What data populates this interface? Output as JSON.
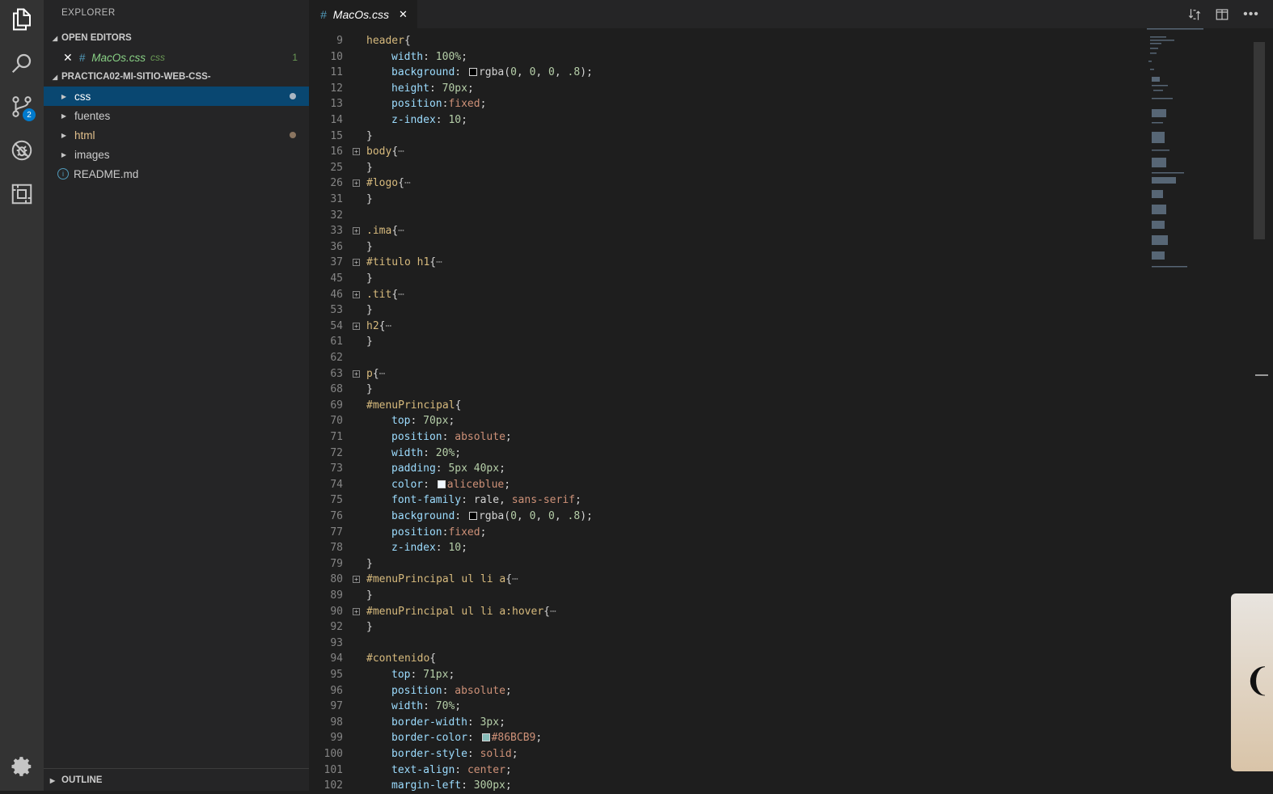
{
  "activity_bar": {
    "icons": [
      "explorer-icon",
      "search-icon",
      "source-control-icon",
      "debug-icon",
      "extensions-icon",
      "gear-icon"
    ],
    "source_control_badge": "2"
  },
  "sidebar": {
    "title": "EXPLORER",
    "open_editors": {
      "heading": "OPEN EDITORS",
      "item": {
        "icon": "#",
        "name": "MacOs.css",
        "folder": "css",
        "count": "1"
      }
    },
    "project": {
      "heading": "PRACTICA02-MI-SITIO-WEB-CSS-",
      "items": [
        {
          "label": "css",
          "type": "folder",
          "selected": true,
          "modified": true
        },
        {
          "label": "fuentes",
          "type": "folder",
          "selected": false,
          "modified": false
        },
        {
          "label": "html",
          "type": "folder",
          "selected": false,
          "modified": true
        },
        {
          "label": "images",
          "type": "folder",
          "selected": false,
          "modified": false
        },
        {
          "label": "README.md",
          "type": "file",
          "selected": false,
          "modified": false
        }
      ]
    },
    "outline_heading": "OUTLINE"
  },
  "editor": {
    "tab": {
      "icon": "#",
      "title": "MacOs.css",
      "close": "✕"
    },
    "lines": [
      {
        "n": "9",
        "fold": false,
        "indent": 0,
        "tokens": [
          [
            "sel",
            "header"
          ],
          [
            "punc",
            "{"
          ]
        ]
      },
      {
        "n": "10",
        "fold": false,
        "indent": 1,
        "tokens": [
          [
            "prop",
            "width"
          ],
          [
            "punc",
            ": "
          ],
          [
            "num",
            "100%"
          ],
          [
            "punc",
            ";"
          ]
        ]
      },
      {
        "n": "11",
        "fold": false,
        "indent": 1,
        "tokens": [
          [
            "prop",
            "background"
          ],
          [
            "punc",
            ": "
          ],
          [
            "swatch",
            "#000000"
          ],
          [
            "punc",
            "rgba("
          ],
          [
            "num",
            "0"
          ],
          [
            "punc",
            ", "
          ],
          [
            "num",
            "0"
          ],
          [
            "punc",
            ", "
          ],
          [
            "num",
            "0"
          ],
          [
            "punc",
            ", "
          ],
          [
            "num",
            ".8"
          ],
          [
            "punc",
            ");"
          ]
        ]
      },
      {
        "n": "12",
        "fold": false,
        "indent": 1,
        "tokens": [
          [
            "prop",
            "height"
          ],
          [
            "punc",
            ": "
          ],
          [
            "num",
            "70px"
          ],
          [
            "punc",
            ";"
          ]
        ]
      },
      {
        "n": "13",
        "fold": false,
        "indent": 1,
        "tokens": [
          [
            "prop",
            "position"
          ],
          [
            "punc",
            ":"
          ],
          [
            "val",
            "fixed"
          ],
          [
            "punc",
            ";"
          ]
        ]
      },
      {
        "n": "14",
        "fold": false,
        "indent": 1,
        "tokens": [
          [
            "prop",
            "z-index"
          ],
          [
            "punc",
            ": "
          ],
          [
            "num",
            "10"
          ],
          [
            "punc",
            ";"
          ]
        ]
      },
      {
        "n": "15",
        "fold": false,
        "indent": 0,
        "tokens": [
          [
            "punc",
            "}"
          ]
        ]
      },
      {
        "n": "16",
        "fold": true,
        "indent": 0,
        "tokens": [
          [
            "sel",
            "body"
          ],
          [
            "punc",
            "{"
          ],
          [
            "dim",
            "⋯"
          ]
        ]
      },
      {
        "n": "25",
        "fold": false,
        "indent": 0,
        "tokens": [
          [
            "punc",
            "}"
          ]
        ]
      },
      {
        "n": "26",
        "fold": true,
        "indent": 0,
        "tokens": [
          [
            "sel",
            "#logo"
          ],
          [
            "punc",
            "{"
          ],
          [
            "dim",
            "⋯"
          ]
        ]
      },
      {
        "n": "31",
        "fold": false,
        "indent": 0,
        "tokens": [
          [
            "punc",
            "}"
          ]
        ]
      },
      {
        "n": "32",
        "fold": false,
        "indent": 0,
        "tokens": []
      },
      {
        "n": "33",
        "fold": true,
        "indent": 0,
        "tokens": [
          [
            "sel",
            ".ima"
          ],
          [
            "punc",
            "{"
          ],
          [
            "dim",
            "⋯"
          ]
        ]
      },
      {
        "n": "36",
        "fold": false,
        "indent": 0,
        "tokens": [
          [
            "punc",
            "}"
          ]
        ]
      },
      {
        "n": "37",
        "fold": true,
        "indent": 0,
        "tokens": [
          [
            "sel",
            "#titulo h1"
          ],
          [
            "punc",
            "{"
          ],
          [
            "dim",
            "⋯"
          ]
        ]
      },
      {
        "n": "45",
        "fold": false,
        "indent": 0,
        "tokens": [
          [
            "punc",
            "}"
          ]
        ]
      },
      {
        "n": "46",
        "fold": true,
        "indent": 0,
        "tokens": [
          [
            "sel",
            ".tit"
          ],
          [
            "punc",
            "{"
          ],
          [
            "dim",
            "⋯"
          ]
        ]
      },
      {
        "n": "53",
        "fold": false,
        "indent": 0,
        "tokens": [
          [
            "punc",
            "}"
          ]
        ]
      },
      {
        "n": "54",
        "fold": true,
        "indent": 0,
        "tokens": [
          [
            "sel",
            "h2"
          ],
          [
            "punc",
            "{"
          ],
          [
            "dim",
            "⋯"
          ]
        ]
      },
      {
        "n": "61",
        "fold": false,
        "indent": 0,
        "tokens": [
          [
            "punc",
            "}"
          ]
        ]
      },
      {
        "n": "62",
        "fold": false,
        "indent": 0,
        "tokens": []
      },
      {
        "n": "63",
        "fold": true,
        "indent": 0,
        "tokens": [
          [
            "sel",
            "p"
          ],
          [
            "punc",
            "{"
          ],
          [
            "dim",
            "⋯"
          ]
        ]
      },
      {
        "n": "68",
        "fold": false,
        "indent": 0,
        "tokens": [
          [
            "punc",
            "}"
          ]
        ]
      },
      {
        "n": "69",
        "fold": false,
        "indent": 0,
        "tokens": [
          [
            "sel",
            "#menuPrincipal"
          ],
          [
            "punc",
            "{"
          ]
        ]
      },
      {
        "n": "70",
        "fold": false,
        "indent": 1,
        "tokens": [
          [
            "prop",
            "top"
          ],
          [
            "punc",
            ": "
          ],
          [
            "num",
            "70px"
          ],
          [
            "punc",
            ";"
          ]
        ]
      },
      {
        "n": "71",
        "fold": false,
        "indent": 1,
        "tokens": [
          [
            "prop",
            "position"
          ],
          [
            "punc",
            ": "
          ],
          [
            "val",
            "absolute"
          ],
          [
            "punc",
            ";"
          ]
        ]
      },
      {
        "n": "72",
        "fold": false,
        "indent": 1,
        "tokens": [
          [
            "prop",
            "width"
          ],
          [
            "punc",
            ": "
          ],
          [
            "num",
            "20%"
          ],
          [
            "punc",
            ";"
          ]
        ]
      },
      {
        "n": "73",
        "fold": false,
        "indent": 1,
        "tokens": [
          [
            "prop",
            "padding"
          ],
          [
            "punc",
            ": "
          ],
          [
            "num",
            "5px 40px"
          ],
          [
            "punc",
            ";"
          ]
        ]
      },
      {
        "n": "74",
        "fold": false,
        "indent": 1,
        "tokens": [
          [
            "prop",
            "color"
          ],
          [
            "punc",
            ": "
          ],
          [
            "swatch",
            "#f0f8ff"
          ],
          [
            "val",
            "aliceblue"
          ],
          [
            "punc",
            ";"
          ]
        ]
      },
      {
        "n": "75",
        "fold": false,
        "indent": 1,
        "tokens": [
          [
            "prop",
            "font-family"
          ],
          [
            "punc",
            ": rale, "
          ],
          [
            "val",
            "sans-serif"
          ],
          [
            "punc",
            ";"
          ]
        ]
      },
      {
        "n": "76",
        "fold": false,
        "indent": 1,
        "tokens": [
          [
            "prop",
            "background"
          ],
          [
            "punc",
            ": "
          ],
          [
            "swatch",
            "#000000"
          ],
          [
            "punc",
            "rgba("
          ],
          [
            "num",
            "0"
          ],
          [
            "punc",
            ", "
          ],
          [
            "num",
            "0"
          ],
          [
            "punc",
            ", "
          ],
          [
            "num",
            "0"
          ],
          [
            "punc",
            ", "
          ],
          [
            "num",
            ".8"
          ],
          [
            "punc",
            ");"
          ]
        ]
      },
      {
        "n": "77",
        "fold": false,
        "indent": 1,
        "tokens": [
          [
            "prop",
            "position"
          ],
          [
            "punc",
            ":"
          ],
          [
            "val",
            "fixed"
          ],
          [
            "punc",
            ";"
          ]
        ]
      },
      {
        "n": "78",
        "fold": false,
        "indent": 1,
        "tokens": [
          [
            "prop",
            "z-index"
          ],
          [
            "punc",
            ": "
          ],
          [
            "num",
            "10"
          ],
          [
            "punc",
            ";"
          ]
        ]
      },
      {
        "n": "79",
        "fold": false,
        "indent": 0,
        "tokens": [
          [
            "punc",
            "}"
          ]
        ]
      },
      {
        "n": "80",
        "fold": true,
        "indent": 0,
        "tokens": [
          [
            "sel",
            "#menuPrincipal ul li a"
          ],
          [
            "punc",
            "{"
          ],
          [
            "dim",
            "⋯"
          ]
        ]
      },
      {
        "n": "89",
        "fold": false,
        "indent": 0,
        "tokens": [
          [
            "punc",
            "}"
          ]
        ]
      },
      {
        "n": "90",
        "fold": true,
        "indent": 0,
        "tokens": [
          [
            "sel",
            "#menuPrincipal ul li a:hover"
          ],
          [
            "punc",
            "{"
          ],
          [
            "dim",
            "⋯"
          ]
        ]
      },
      {
        "n": "92",
        "fold": false,
        "indent": 0,
        "tokens": [
          [
            "punc",
            "}"
          ]
        ]
      },
      {
        "n": "93",
        "fold": false,
        "indent": 0,
        "tokens": []
      },
      {
        "n": "94",
        "fold": false,
        "indent": 0,
        "tokens": [
          [
            "sel",
            "#contenido"
          ],
          [
            "punc",
            "{"
          ]
        ]
      },
      {
        "n": "95",
        "fold": false,
        "indent": 1,
        "tokens": [
          [
            "prop",
            "top"
          ],
          [
            "punc",
            ": "
          ],
          [
            "num",
            "71px"
          ],
          [
            "punc",
            ";"
          ]
        ]
      },
      {
        "n": "96",
        "fold": false,
        "indent": 1,
        "tokens": [
          [
            "prop",
            "position"
          ],
          [
            "punc",
            ": "
          ],
          [
            "val",
            "absolute"
          ],
          [
            "punc",
            ";"
          ]
        ]
      },
      {
        "n": "97",
        "fold": false,
        "indent": 1,
        "tokens": [
          [
            "prop",
            "width"
          ],
          [
            "punc",
            ": "
          ],
          [
            "num",
            "70%"
          ],
          [
            "punc",
            ";"
          ]
        ]
      },
      {
        "n": "98",
        "fold": false,
        "indent": 1,
        "tokens": [
          [
            "prop",
            "border-width"
          ],
          [
            "punc",
            ": "
          ],
          [
            "num",
            "3px"
          ],
          [
            "punc",
            ";"
          ]
        ]
      },
      {
        "n": "99",
        "fold": false,
        "indent": 1,
        "tokens": [
          [
            "prop",
            "border-color"
          ],
          [
            "punc",
            ": "
          ],
          [
            "swatch",
            "#86BCB9"
          ],
          [
            "val",
            "#86BCB9"
          ],
          [
            "punc",
            ";"
          ]
        ]
      },
      {
        "n": "100",
        "fold": false,
        "indent": 1,
        "tokens": [
          [
            "prop",
            "border-style"
          ],
          [
            "punc",
            ": "
          ],
          [
            "val",
            "solid"
          ],
          [
            "punc",
            ";"
          ]
        ]
      },
      {
        "n": "101",
        "fold": false,
        "indent": 1,
        "tokens": [
          [
            "prop",
            "text-align"
          ],
          [
            "punc",
            ": "
          ],
          [
            "val",
            "center"
          ],
          [
            "punc",
            ";"
          ]
        ]
      },
      {
        "n": "102",
        "fold": false,
        "indent": 1,
        "tokens": [
          [
            "prop",
            "margin-left"
          ],
          [
            "punc",
            ": "
          ],
          [
            "num",
            "300px"
          ],
          [
            "punc",
            ";"
          ]
        ]
      }
    ]
  },
  "side_widget": {
    "glyph": "❨"
  }
}
